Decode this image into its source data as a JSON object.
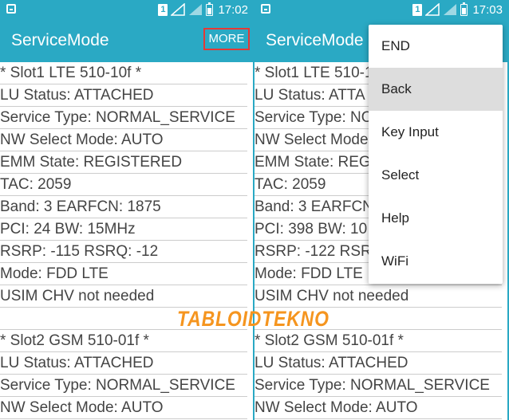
{
  "left": {
    "status": {
      "sim_badge": "1",
      "time": "17:02"
    },
    "app_bar": {
      "title": "ServiceMode",
      "more_label": "MORE"
    },
    "lines": [
      "* Slot1 LTE 510-10f *",
      "LU Status: ATTACHED",
      "Service Type: NORMAL_SERVICE",
      "NW Select Mode: AUTO",
      "EMM State: REGISTERED",
      "TAC: 2059",
      "Band: 3  EARFCN: 1875",
      "PCI: 24  BW: 15MHz",
      "RSRP: -115  RSRQ: -12",
      "Mode: FDD LTE",
      "USIM CHV not needed",
      "",
      "* Slot2 GSM 510-01f *",
      "LU Status: ATTACHED",
      "Service Type: NORMAL_SERVICE",
      "NW Select Mode: AUTO"
    ]
  },
  "right": {
    "status": {
      "sim_badge": "1",
      "time": "17:03"
    },
    "app_bar": {
      "title": "ServiceMode"
    },
    "lines": [
      "* Slot1 LTE 510-1",
      "LU Status: ATTA",
      "Service Type: NO",
      "NW Select Mode",
      "EMM State: REG",
      "TAC: 2059",
      "Band: 3  EARFCN",
      "PCI: 398  BW: 10",
      "RSRP: -122  RSR",
      "Mode: FDD LTE",
      "USIM CHV not needed",
      "",
      "* Slot2 GSM 510-01f *",
      "LU Status: ATTACHED",
      "Service Type: NORMAL_SERVICE",
      "NW Select Mode: AUTO"
    ],
    "menu": {
      "items": [
        "END",
        "Back",
        "Key Input",
        "Select",
        "Help",
        "WiFi"
      ],
      "active_index": 1
    }
  },
  "watermark": "TABLOIDTEKNO",
  "colors": {
    "accent": "#2aa9c4",
    "highlight_box": "#e53935",
    "watermark": "#f5951f"
  }
}
